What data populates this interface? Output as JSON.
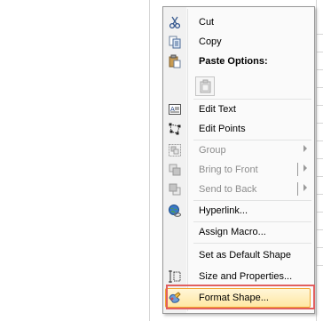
{
  "menu": {
    "items": [
      {
        "label": "Cut",
        "icon": "scissors-icon",
        "enabled": true
      },
      {
        "label": "Copy",
        "icon": "copy-icon",
        "enabled": true
      },
      {
        "label": "Paste Options:",
        "icon": "paste-icon",
        "enabled": true
      },
      {
        "label": "Edit Text",
        "icon": "edit-text-icon",
        "enabled": true
      },
      {
        "label": "Edit Points",
        "icon": "edit-points-icon",
        "enabled": true
      },
      {
        "label": "Group",
        "icon": "group-icon",
        "enabled": false
      },
      {
        "label": "Bring to Front",
        "icon": "bring-to-front-icon",
        "enabled": false
      },
      {
        "label": "Send to Back",
        "icon": "send-to-back-icon",
        "enabled": false
      },
      {
        "label": "Hyperlink...",
        "icon": "hyperlink-icon",
        "enabled": true
      },
      {
        "label": "Assign Macro...",
        "icon": "",
        "enabled": true
      },
      {
        "label": "Set as Default Shape",
        "icon": "",
        "enabled": true
      },
      {
        "label": "Size and Properties...",
        "icon": "size-properties-icon",
        "enabled": true
      },
      {
        "label": "Format Shape...",
        "icon": "format-shape-icon",
        "enabled": true,
        "highlighted": true
      }
    ],
    "paste_button_icon": "paste-picture-icon"
  },
  "colors": {
    "highlight_border": "#f2a32d",
    "annotation_box": "#e15f5f",
    "disabled_text": "#8d8d8d"
  }
}
